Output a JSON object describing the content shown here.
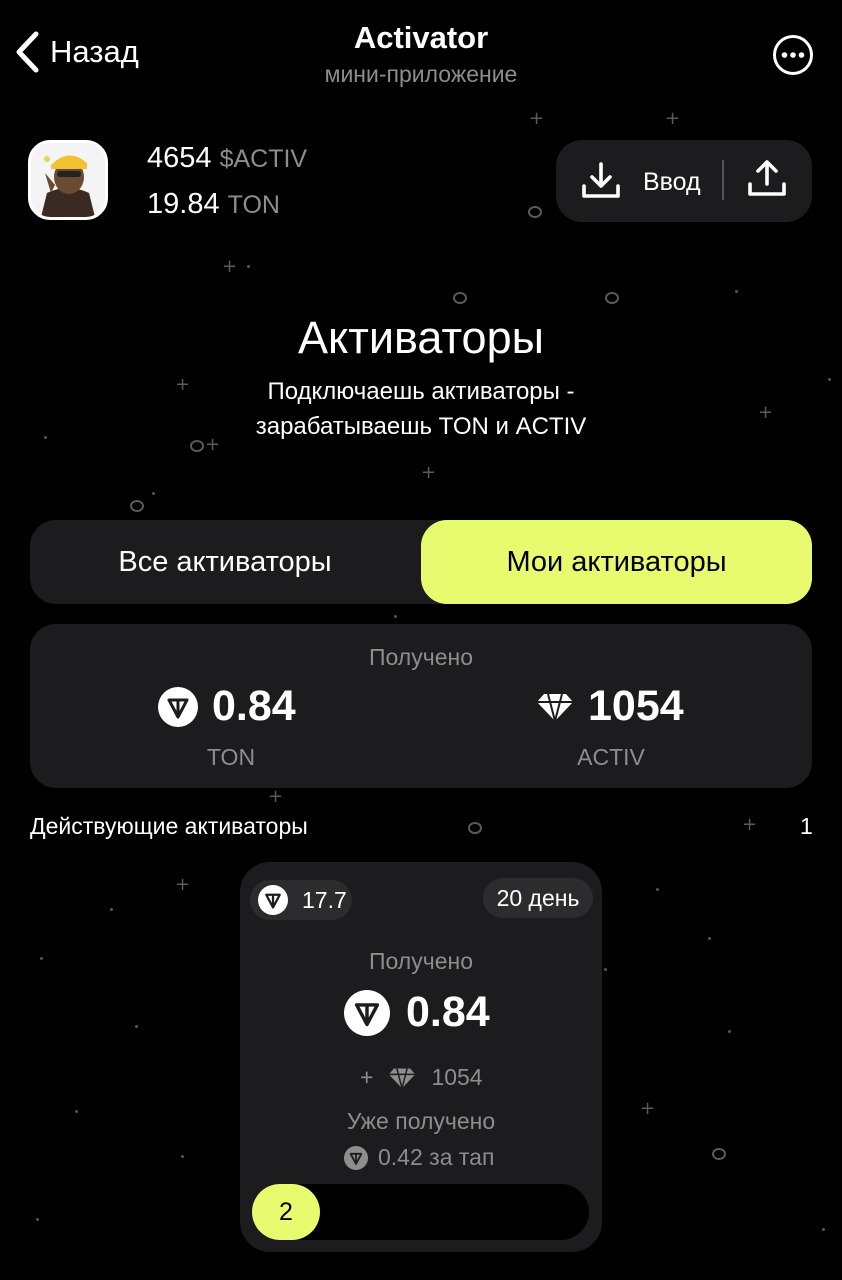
{
  "header": {
    "back_label": "Назад",
    "title": "Activator",
    "subtitle": "мини-приложение"
  },
  "balance": {
    "activ_amount": "4654",
    "activ_unit": "$ACTIV",
    "ton_amount": "19.84",
    "ton_unit": "TON"
  },
  "wallet": {
    "deposit_label": "Ввод"
  },
  "hero": {
    "title": "Активаторы",
    "line1": "Подключаешь активаторы -",
    "line2": "зарабатываешь TON и ACTIV"
  },
  "tabs": [
    {
      "label": "Все активаторы",
      "active": false
    },
    {
      "label": "Мои активаторы",
      "active": true
    }
  ],
  "summary": {
    "label": "Получено",
    "ton_value": "0.84",
    "ton_unit": "TON",
    "activ_value": "1054",
    "activ_unit": "ACTIV"
  },
  "active_section": {
    "title": "Действующие активаторы",
    "count": "1"
  },
  "activator_card": {
    "price": "17.7",
    "day_badge": "20 день",
    "received_label": "Получено",
    "received_ton": "0.84",
    "plus": "+",
    "bonus_activ": "1054",
    "already_label": "Уже получено",
    "per_tap": "0.42 за тап",
    "progress_label": "2"
  },
  "colors": {
    "background": "#000000",
    "card": "#1c1c1e",
    "accent": "#e8fb6f",
    "muted": "#8d8d8d"
  },
  "icons": [
    "chevron-left-icon",
    "more-icon",
    "download-icon",
    "upload-icon",
    "ton-icon",
    "diamond-icon"
  ]
}
